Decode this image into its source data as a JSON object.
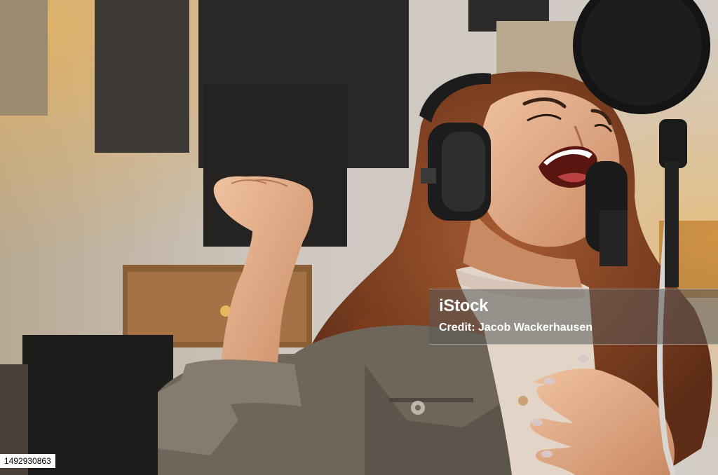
{
  "watermark": {
    "brand": "iStock",
    "credit": "Credit: Jacob Wackerhausen"
  },
  "image_id": "1492930863",
  "colors": {
    "wall": "#c9c2bb",
    "panel": "#2a2826",
    "hair": "#8a4a2a",
    "jacket": "#6e665a",
    "sweater": "#e3d4c8",
    "skin": "#e8b28e",
    "headphones": "#1c1c1c"
  }
}
